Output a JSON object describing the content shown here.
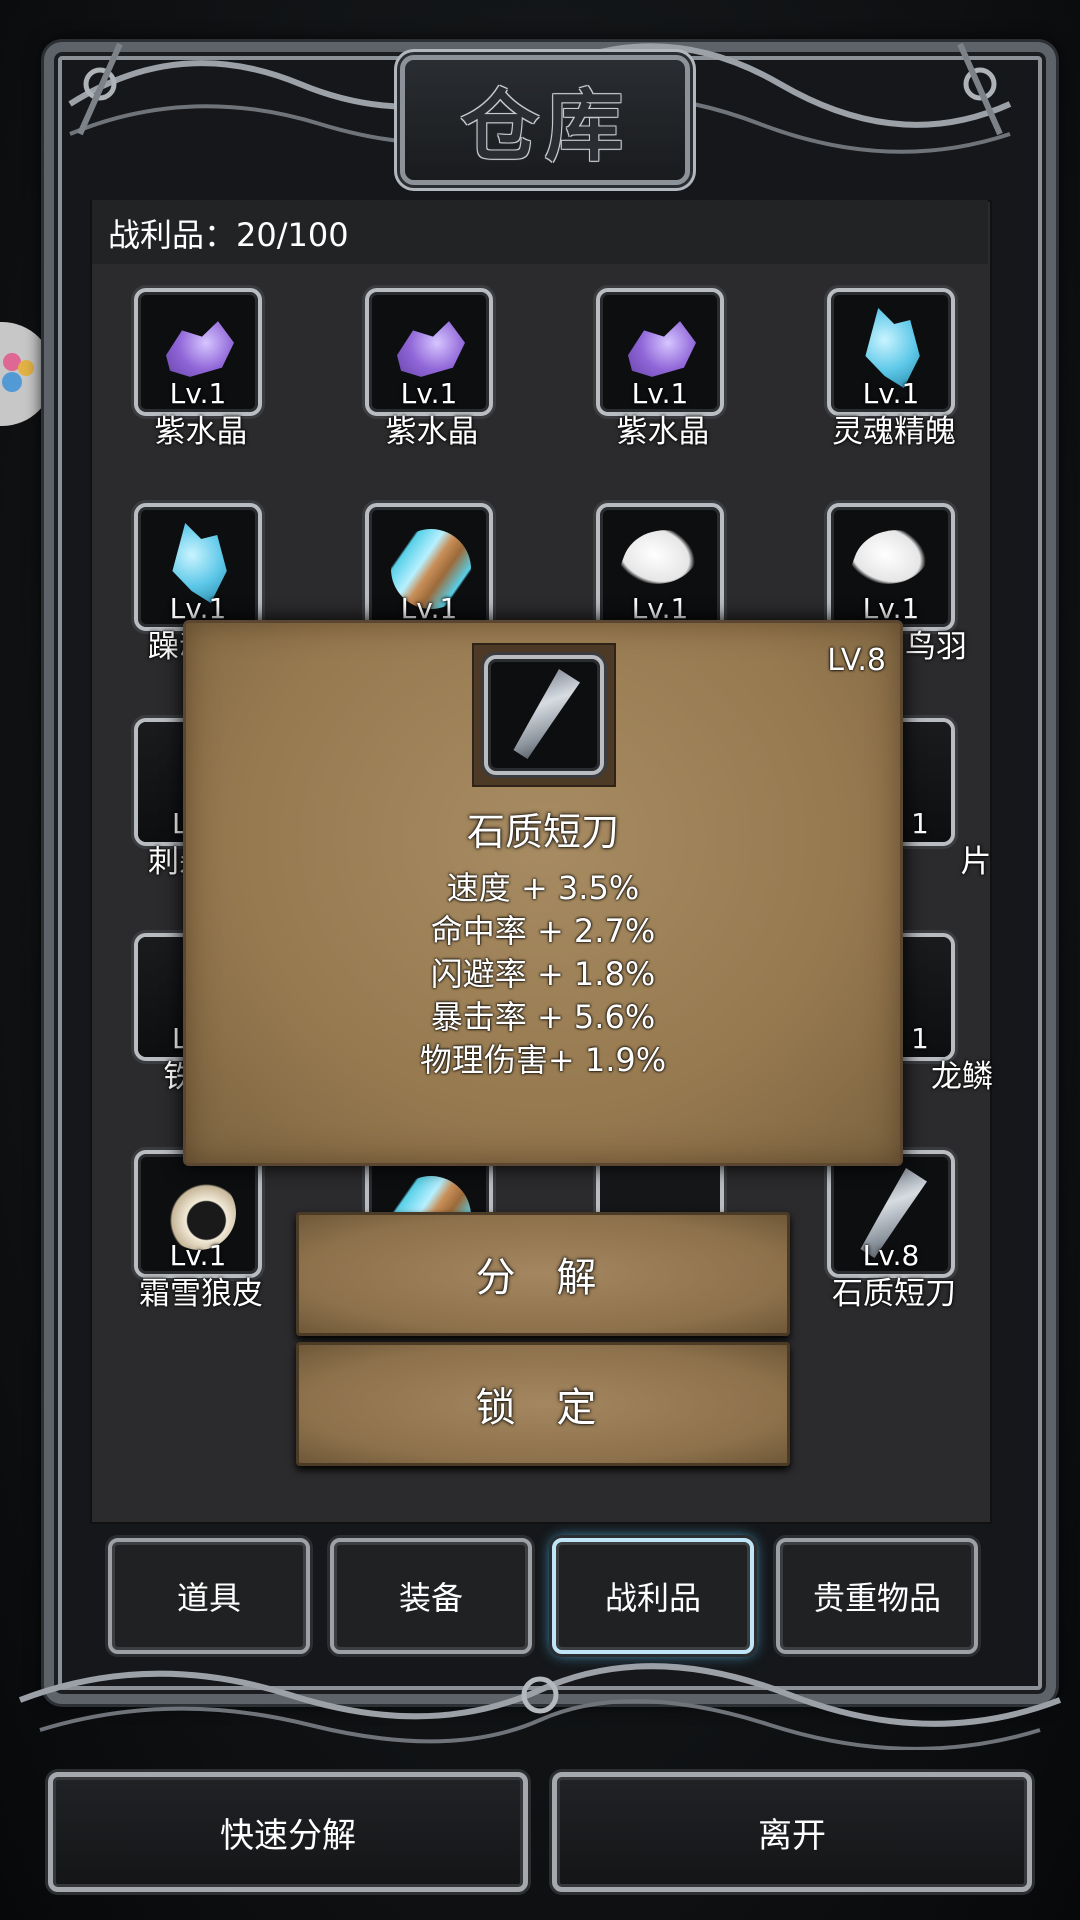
{
  "title": "仓库",
  "inventory": {
    "count_label": "战利品：20/100"
  },
  "grid": [
    {
      "name": "紫水晶",
      "level": "Lv.1",
      "icon": "amethyst-icon"
    },
    {
      "name": "紫水晶",
      "level": "Lv.1",
      "icon": "amethyst-icon"
    },
    {
      "name": "紫水晶",
      "level": "Lv.1",
      "icon": "amethyst-icon"
    },
    {
      "name": "灵魂精魄",
      "level": "Lv.1",
      "icon": "soul-essence-icon"
    },
    {
      "name": "躁动",
      "level": "Lv.1",
      "icon": "restless-crystal-icon"
    },
    {
      "name": "",
      "level": "Lv.1",
      "icon": "scale-icon"
    },
    {
      "name": "",
      "level": "Lv.1",
      "icon": "feather-icon"
    },
    {
      "name": "鸟羽",
      "level": "Lv.1",
      "icon": "feather-icon"
    },
    {
      "name": "刺杀",
      "level": "Lv",
      "icon": "item-icon"
    },
    {
      "name": "片",
      "level": "1",
      "icon": "item-icon"
    },
    {
      "name": "铁",
      "level": "L",
      "icon": "item-icon"
    },
    {
      "name": "龙鳞",
      "level": "1",
      "icon": "dragon-scale-icon"
    },
    {
      "name": "霜雪狼皮",
      "level": "Lv.1",
      "icon": "wolf-fur-icon"
    },
    {
      "name": "",
      "level": "",
      "icon": "scale-icon"
    },
    {
      "name": "",
      "level": "",
      "icon": "item-icon"
    },
    {
      "name": "石质短刀",
      "level": "Lv.8",
      "icon": "stone-knife-icon"
    }
  ],
  "popup": {
    "level": "LV.8",
    "item_name": "石质短刀",
    "icon": "stone-knife-icon",
    "stats": [
      "速度 + 3.5%",
      "命中率 + 2.7%",
      "闪避率 + 1.8%",
      "暴击率 + 5.6%",
      "物理伤害+ 1.9%"
    ],
    "decompose_label": "分 解",
    "lock_label": "锁 定"
  },
  "tabs": [
    "道具",
    "装备",
    "战利品",
    "贵重物品"
  ],
  "active_tab": "战利品",
  "actions": {
    "quick_decompose": "快速分解",
    "leave": "离开"
  },
  "colors": {
    "tab_glow": "#4fb7e6",
    "parchment": "#96794f",
    "frame": "#8c9197"
  }
}
